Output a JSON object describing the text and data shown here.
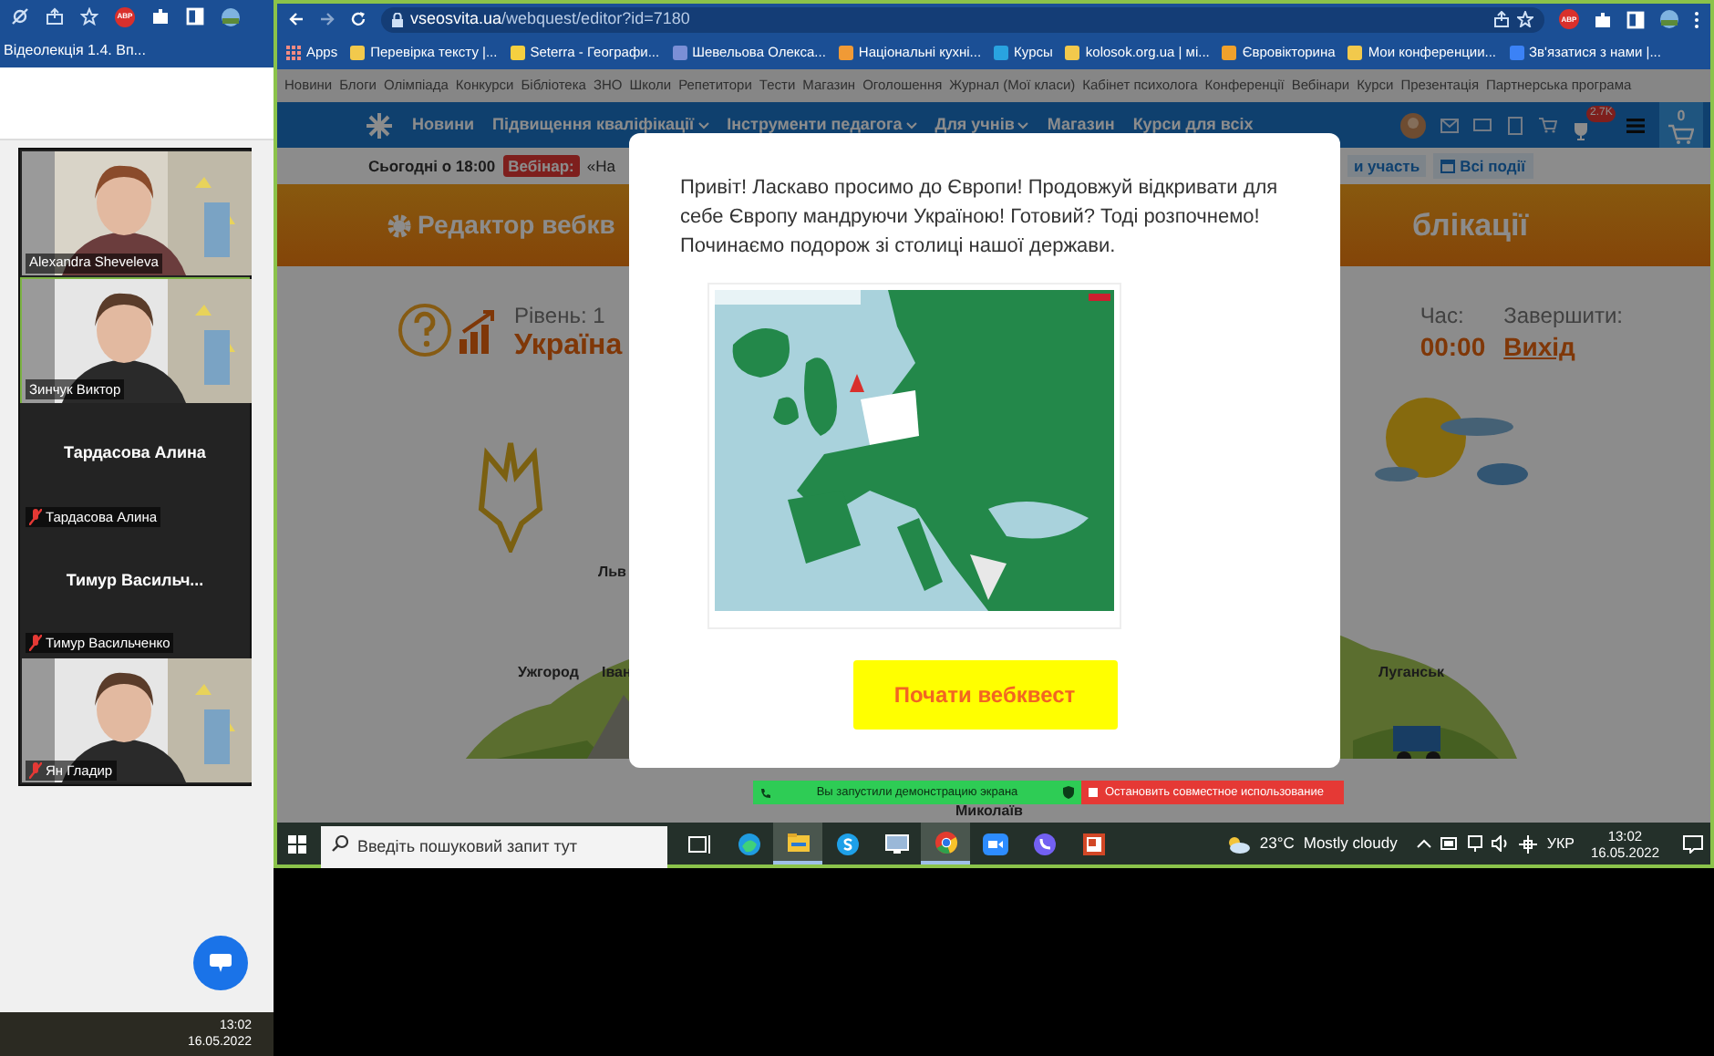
{
  "left_panel": {
    "bookmark": "Відеолекція 1.4. Вп...",
    "extension_badge": "ABP",
    "participants": [
      {
        "kind": "video",
        "name": "Alexandra Sheveleva",
        "muted": false,
        "selected": false
      },
      {
        "kind": "video",
        "name": "Зинчук Виктор",
        "muted": false,
        "selected": true
      },
      {
        "kind": "avatar",
        "display": "Тардасова Алина",
        "name": "Тардасова Алина",
        "muted": true,
        "selected": false
      },
      {
        "kind": "avatar",
        "display": "Тимур  Васильч...",
        "name": "Тимур Васильченко",
        "muted": true,
        "selected": false
      },
      {
        "kind": "video",
        "name": "Ян Гладир",
        "muted": true,
        "selected": false
      }
    ],
    "clock": {
      "time": "13:02",
      "date": "16.05.2022"
    }
  },
  "browser": {
    "url_host": "vseosvita.ua",
    "url_path": "/webquest/editor?id=7180",
    "extension_badge": "ABP",
    "bookmarks": [
      "Apps",
      "Перевірка тексту |...",
      "Seterra - Географи...",
      "Шевельова Олекса...",
      "Національні кухні...",
      "Курсы",
      "kolosok.org.ua | мі...",
      "Євровікторина",
      "Мои конференции...",
      "Зв'язатися з нами |..."
    ]
  },
  "site": {
    "top_links": [
      "Новини",
      "Блоги",
      "Олімпіада",
      "Конкурси",
      "Бібліотека",
      "ЗНО",
      "Школи",
      "Репетитори",
      "Тести",
      "Магазин",
      "Оголошення",
      "Журнал (Мої класи)",
      "Кабінет психолога",
      "Конференції",
      "Вебінари",
      "Курси",
      "Презентація",
      "Партнерська програма"
    ],
    "nav": [
      "Новини",
      "Підвищення кваліфікації",
      "Інструменти педагога",
      "Для учнів",
      "Магазин",
      "Курси для всіх"
    ],
    "badge": "2.7K",
    "cart_count": "0",
    "announce": {
      "time": "Сьогодні о 18:00",
      "label": "Вебінар:",
      "title": "«На",
      "join": "и участь",
      "events": "Всі події"
    },
    "editor_title": "Редактор вебкв",
    "editor_title_end": "блікації",
    "level": "Рівень: 1",
    "country": "Україна",
    "time_label": "Час:",
    "time": "00:00",
    "finish_label": "Завершити:",
    "exit": "Вихід",
    "map_labels": [
      "Льв",
      "Ужгород",
      "Іван",
      "Луганськ",
      "Миколаїв"
    ]
  },
  "modal": {
    "text": "Привіт! Ласкаво просимо до Європи! Продовжуй відкривати для себе Європу мандруючи Україною! Готовий? Тоді розпочнемо! Починаємо подорож зі столиці нашої держави.",
    "button": "Почати вебквест"
  },
  "share_bar": {
    "status": "Вы запустили демонстрацию экрана",
    "stop": "Остановить совместное использование"
  },
  "taskbar": {
    "search_placeholder": "Введіть пошуковий запит тут",
    "apps": [
      {
        "kind": "taskview",
        "active": false
      },
      {
        "kind": "edge",
        "active": false
      },
      {
        "kind": "files",
        "active": true
      },
      {
        "kind": "skype",
        "active": false
      },
      {
        "kind": "remote",
        "active": false
      },
      {
        "kind": "chrome",
        "active": true
      },
      {
        "kind": "zoom",
        "active": false
      },
      {
        "kind": "viber",
        "active": false
      },
      {
        "kind": "slides",
        "active": false
      }
    ],
    "temperature": "23°C",
    "weather": "Mostly cloudy",
    "language": "УКР",
    "time": "13:02",
    "date": "16.05.2022"
  }
}
